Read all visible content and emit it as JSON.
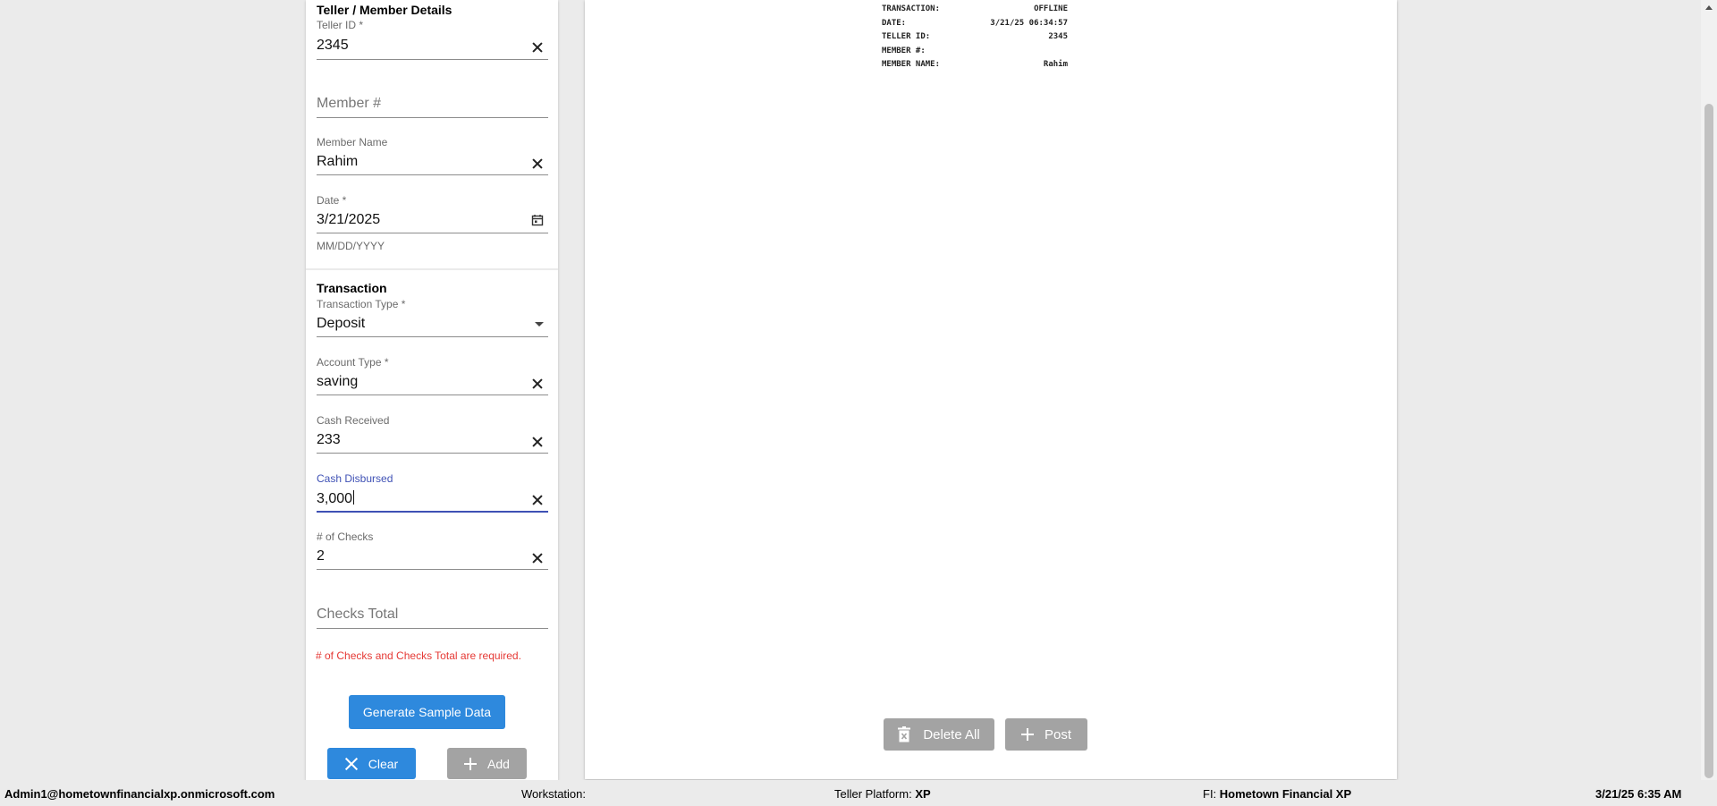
{
  "teller_section": {
    "title": "Teller / Member Details",
    "teller_id": {
      "label": "Teller ID *",
      "value": "2345"
    },
    "member_number": {
      "placeholder": "Member #"
    },
    "member_name": {
      "label": "Member Name",
      "value": "Rahim"
    },
    "date": {
      "label": "Date *",
      "value": "3/21/2025",
      "helper": "MM/DD/YYYY"
    }
  },
  "transaction_section": {
    "title": "Transaction",
    "transaction_type": {
      "label": "Transaction Type *",
      "value": "Deposit"
    },
    "account_type": {
      "label": "Account Type *",
      "value": "saving"
    },
    "cash_received": {
      "label": "Cash Received",
      "value": "233"
    },
    "cash_disbursed": {
      "label": "Cash Disbursed",
      "value": "3,000"
    },
    "num_checks": {
      "label": "# of Checks",
      "value": "2"
    },
    "checks_total": {
      "placeholder": "Checks Total"
    },
    "error": "# of Checks and Checks Total are required."
  },
  "buttons": {
    "generate": "Generate Sample Data",
    "clear": "Clear",
    "add": "Add",
    "delete_all": "Delete All",
    "post": "Post"
  },
  "receipt": {
    "rows": [
      {
        "key": "TRANSACTION:",
        "value": "OFFLINE"
      },
      {
        "key": "DATE:",
        "value": "3/21/25 06:34:57"
      },
      {
        "key": "TELLER ID:",
        "value": "2345"
      },
      {
        "key": "MEMBER #:",
        "value": ""
      },
      {
        "key": "MEMBER NAME:",
        "value": "Rahim"
      }
    ]
  },
  "statusbar": {
    "user": "Admin1@hometownfinancialxp.onmicrosoft.com",
    "workstation_label": "Workstation:",
    "workstation_value": "",
    "platform_label": "Teller Platform:",
    "platform_value": "XP",
    "fi_label": "FI:",
    "fi_value": "Hometown Financial XP",
    "datetime": "3/21/25 6:35 AM"
  },
  "colors": {
    "primary_button": "#2e89dd",
    "disabled_button": "#a3a3a3",
    "focus": "#3f51b5",
    "error": "#e53935"
  }
}
